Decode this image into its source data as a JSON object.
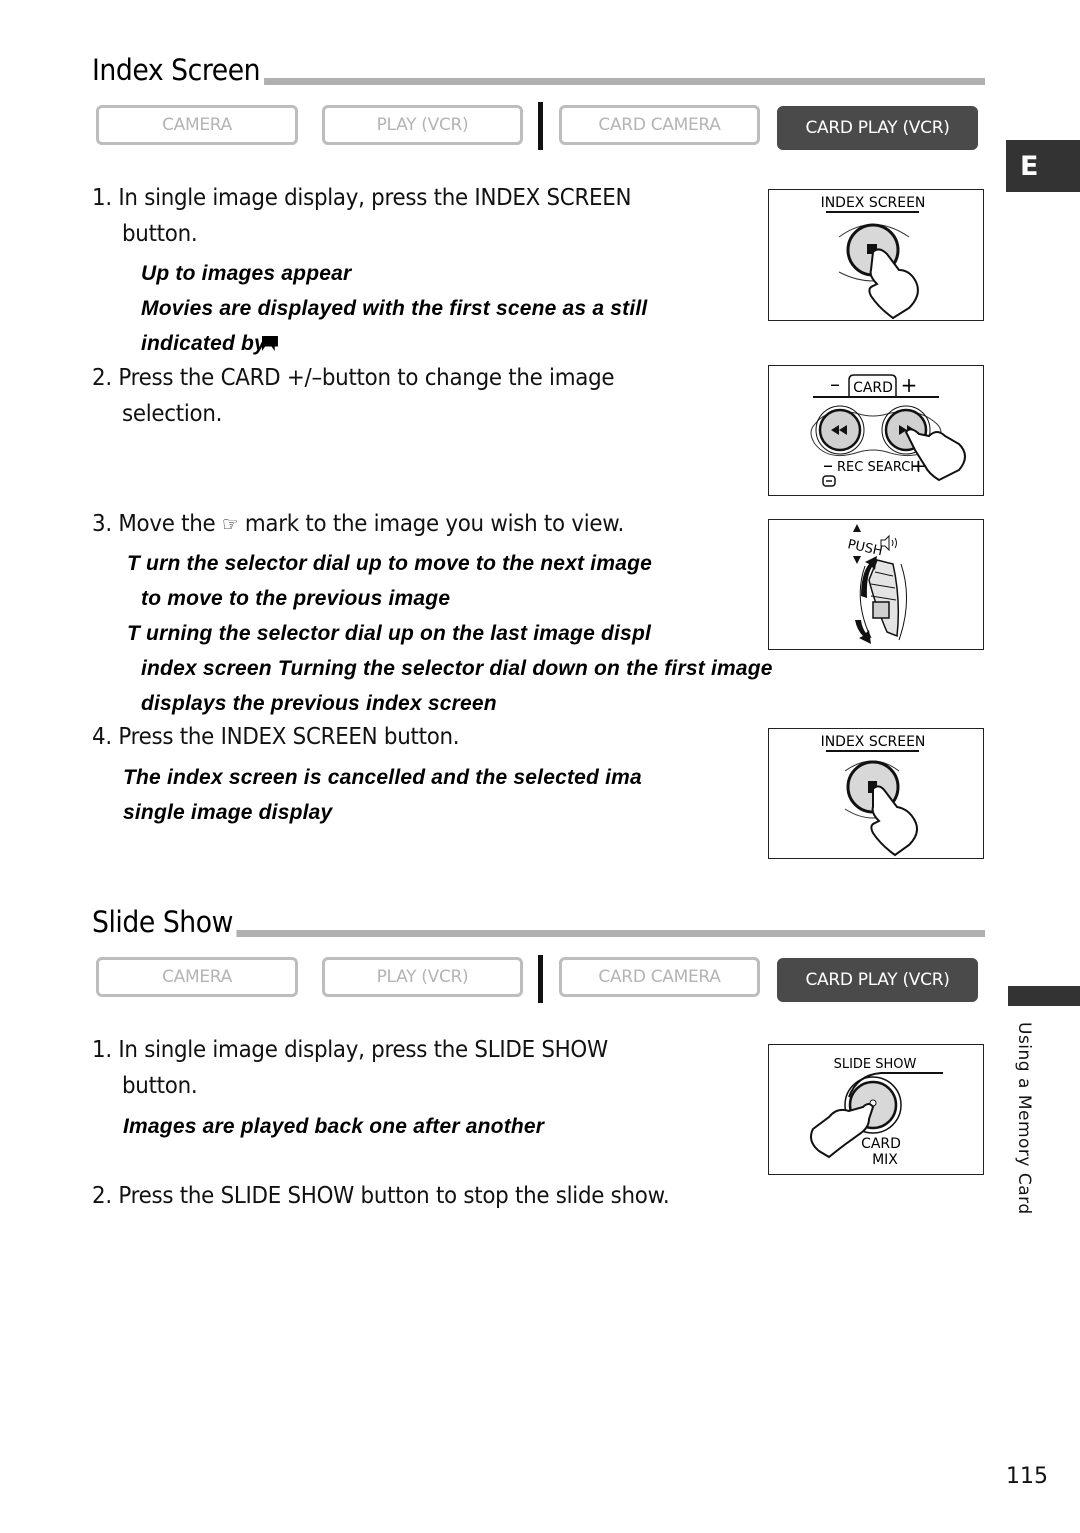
{
  "sections": {
    "index": {
      "title": "Index Screen",
      "modes": [
        "CAMERA",
        "PLAY (VCR)",
        "CARD CAMERA",
        "CARD PLAY (VCR)"
      ],
      "active_mode": "CARD PLAY (VCR)",
      "steps": [
        {
          "line1": "1. In single image display, press the INDEX SCREEN",
          "line2": "button.",
          "notes": [
            "Up to    images appear",
            "Movies are displayed with the first scene as a still",
            "indicated by"
          ]
        },
        {
          "line1": "2. Press the CARD +/–button to change the image",
          "line2": "selection."
        },
        {
          "line1_pre": "3. Move the",
          "line1_post": "mark to the image you wish to view.",
          "notes": [
            "T urn the selector dial up to move to the next image",
            "to move to the previous image",
            "T urning the selector dial up on the last image displ",
            "index screen  Turning the selector dial down on the first image",
            "displays the previous index screen"
          ]
        },
        {
          "line1": "4. Press the  INDEX SCREEN button.",
          "notes": [
            "The index screen is cancelled and the selected ima",
            "single image display"
          ]
        }
      ],
      "figures": {
        "index_button_label": "INDEX SCREEN",
        "card_label": "CARD",
        "card_minus": "–",
        "card_plus": "+",
        "rec_search_label": "REC SEARCH",
        "push_label": "PUSH"
      }
    },
    "slideshow": {
      "title": "Slide Show",
      "modes": [
        "CAMERA",
        "PLAY (VCR)",
        "CARD CAMERA",
        "CARD PLAY (VCR)"
      ],
      "active_mode": "CARD PLAY (VCR)",
      "steps": [
        {
          "line1": "1. In single image display, press the SLIDE SHOW",
          "line2": "button.",
          "notes": [
            "Images are played back one after another"
          ]
        },
        {
          "line1": "2. Press the SLIDE SHOW button to stop the slide show."
        }
      ],
      "figures": {
        "slide_show_label": "SLIDE SHOW",
        "card_mix_line1": "CARD",
        "card_mix_line2": "MIX"
      }
    }
  },
  "side_tab": {
    "letter": "E",
    "chapter": "Using a Memory Card"
  },
  "page_number": "115",
  "colors": {
    "active_mode_bg": "#4a4a4a",
    "inactive_mode": "#b4b4b4",
    "rule": "#b0b0b0",
    "tab": "#333333"
  }
}
